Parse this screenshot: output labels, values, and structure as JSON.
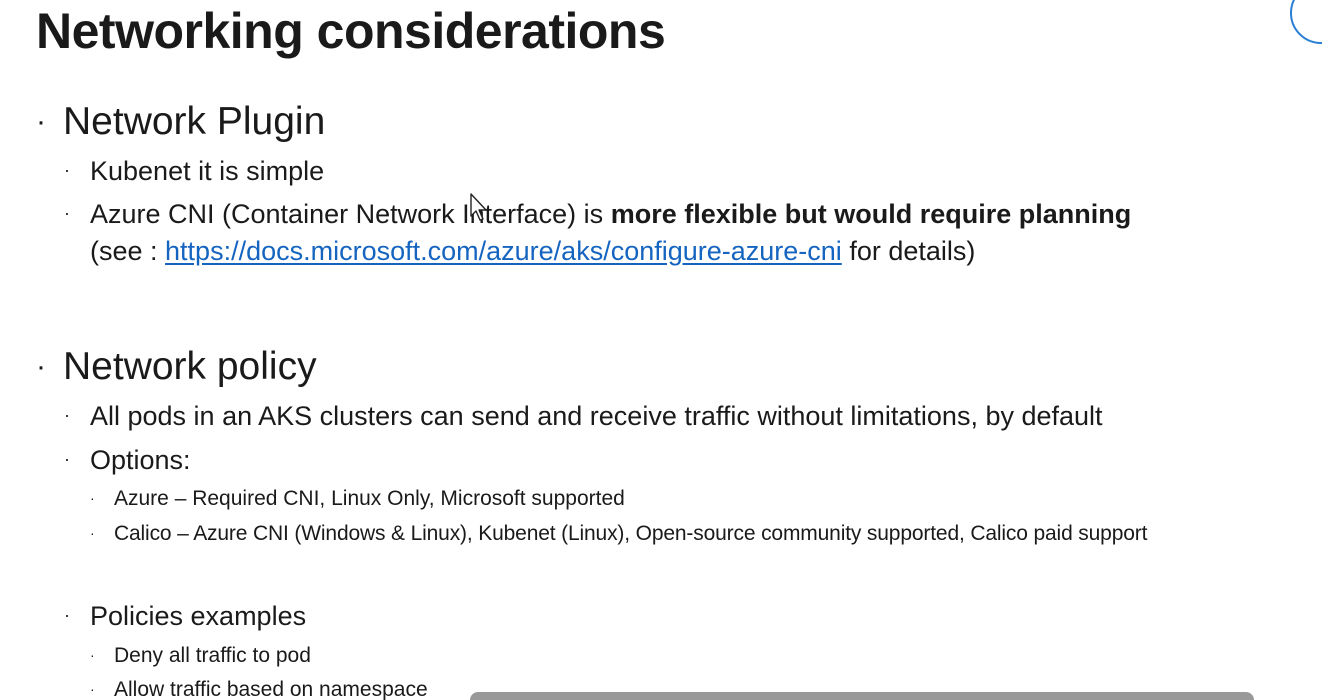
{
  "title": "Networking considerations",
  "bullet_glyph": "·",
  "sections": [
    {
      "heading": "Network Plugin",
      "items": [
        {
          "text": "Kubenet it is simple"
        },
        {
          "text_before_bold": "Azure CNI (Container Network Interface) is ",
          "bold": "more flexible but would require planning",
          "line2_prefix": "(see : ",
          "link": "https://docs.microsoft.com/azure/aks/configure-azure-cni",
          "line2_suffix": " for details)"
        }
      ]
    },
    {
      "heading": "Network policy",
      "items": [
        {
          "text": "All pods in an AKS clusters can send and receive traffic without limitations, by default"
        },
        {
          "text": "Options:",
          "subitems": [
            "Azure – Required CNI, Linux Only, Microsoft supported",
            "Calico – Azure CNI (Windows & Linux), Kubenet (Linux), Open-source community supported, Calico paid support"
          ]
        },
        {
          "text": "Policies examples",
          "subitems": [
            "Deny all traffic to pod",
            "Allow traffic based on namespace"
          ]
        }
      ]
    }
  ],
  "icons": {
    "corner": "circle-logo-icon",
    "cursor": "mouse-pointer-icon"
  },
  "colors": {
    "link": "#1565c0",
    "text": "#1a1a1a",
    "ring": "#2a7fd4"
  }
}
